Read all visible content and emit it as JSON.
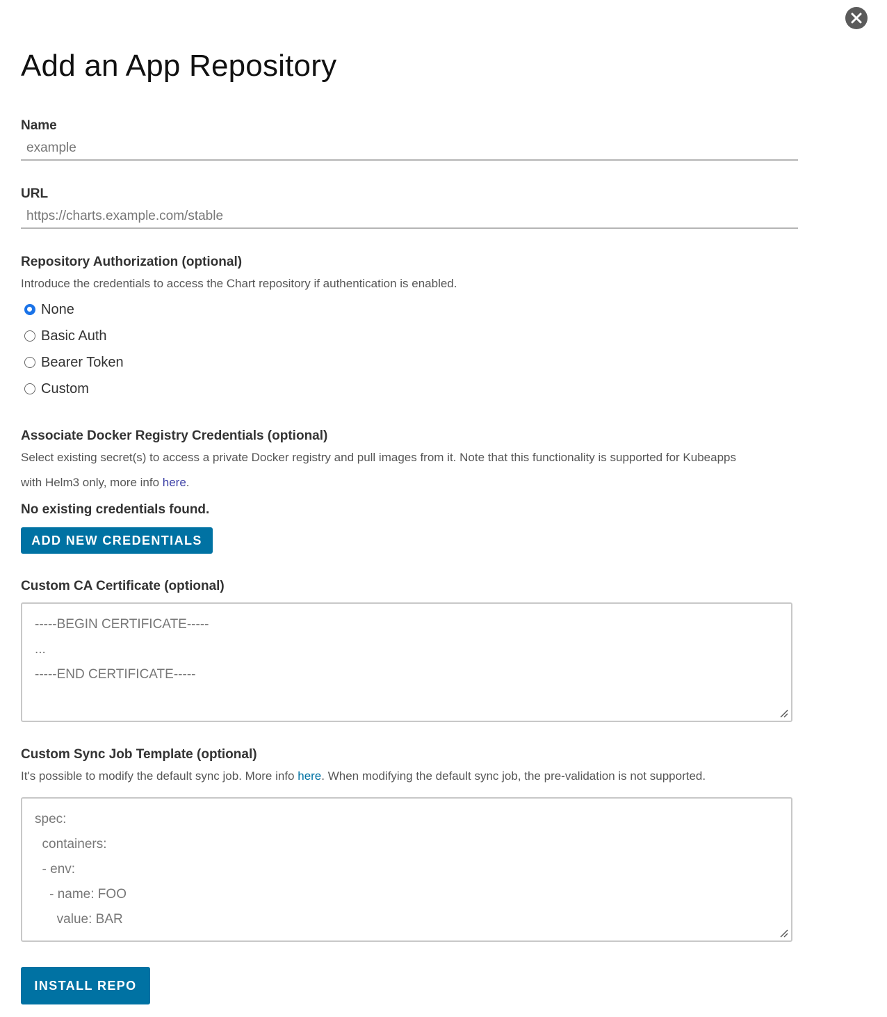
{
  "dialog": {
    "title": "Add an App Repository",
    "close_icon": "close-circle-icon"
  },
  "name_field": {
    "label": "Name",
    "placeholder": "example",
    "value": ""
  },
  "url_field": {
    "label": "URL",
    "placeholder": "https://charts.example.com/stable",
    "value": ""
  },
  "auth": {
    "label": "Repository Authorization (optional)",
    "description": "Introduce the credentials to access the Chart repository if authentication is enabled.",
    "options": [
      {
        "label": "None",
        "checked": true
      },
      {
        "label": "Basic Auth",
        "checked": false
      },
      {
        "label": "Bearer Token",
        "checked": false
      },
      {
        "label": "Custom",
        "checked": false
      }
    ]
  },
  "docker_creds": {
    "label": "Associate Docker Registry Credentials (optional)",
    "description_line1": "Select existing secret(s) to access a private Docker registry and pull images from it. Note that this functionality is supported for Kubeapps",
    "description_line2_prefix": "with Helm3 only, more info ",
    "link_text": "here",
    "description_line2_suffix": ".",
    "empty_message": "No existing credentials found.",
    "add_button": "ADD NEW CREDENTIALS"
  },
  "ca_cert": {
    "label": "Custom CA Certificate (optional)",
    "placeholder_lines": [
      "-----BEGIN CERTIFICATE-----",
      "...",
      "-----END CERTIFICATE-----"
    ]
  },
  "sync_job": {
    "label": "Custom Sync Job Template (optional)",
    "description_prefix": "It's possible to modify the default sync job. More info ",
    "link_text": "here",
    "description_suffix": ". When modifying the default sync job, the pre-validation is not supported.",
    "placeholder_lines": [
      "spec:",
      "  containers:",
      "  - env:",
      "    - name: FOO",
      "      value: BAR"
    ]
  },
  "submit": {
    "label": "INSTALL REPO"
  },
  "colors": {
    "primary_button": "#0072a3",
    "radio_checked": "#1a73e8",
    "close_button": "#5b5b5b",
    "link": "#0072a3"
  }
}
